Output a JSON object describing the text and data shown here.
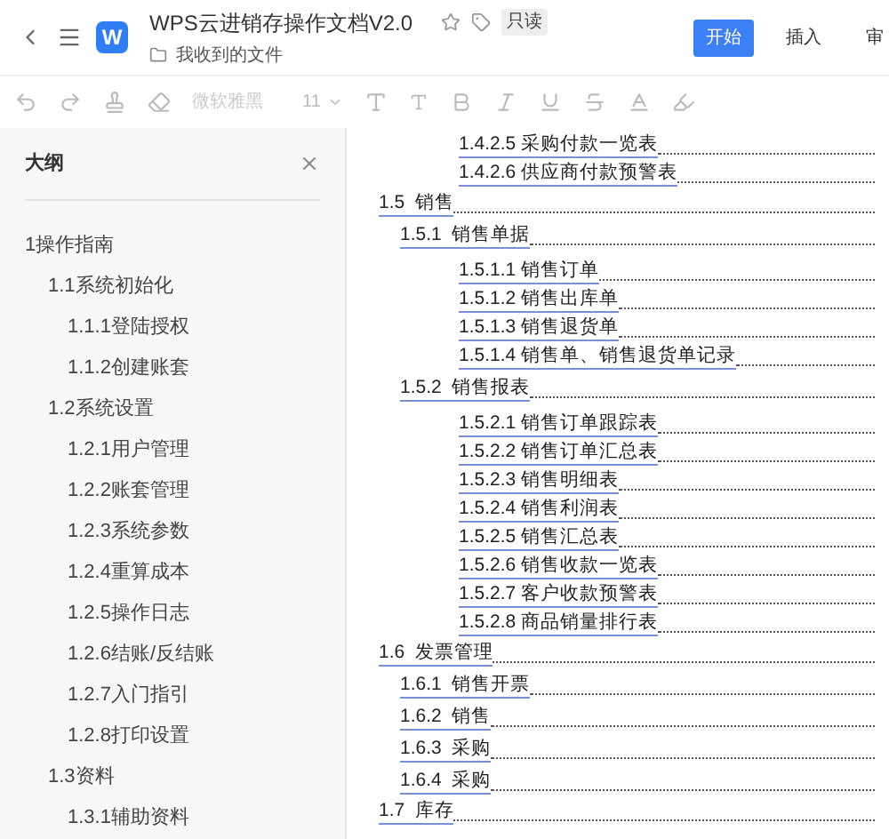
{
  "header": {
    "logo": "W",
    "title": "WPS云进销存操作文档V2.0",
    "badge": "只读",
    "folder": "我收到的文件",
    "tabs": [
      {
        "label": "开始",
        "selected": true
      },
      {
        "label": "插入",
        "selected": false
      },
      {
        "label": "审",
        "selected": false
      }
    ]
  },
  "toolbar": {
    "font": "微软雅黑",
    "size": "11"
  },
  "outline": {
    "title": "大纲",
    "items": [
      {
        "text": "1操作指南",
        "children": [
          {
            "text": "1.1系统初始化",
            "children": [
              {
                "text": "1.1.1登陆授权"
              },
              {
                "text": "1.1.2创建账套"
              }
            ]
          },
          {
            "text": "1.2系统设置",
            "children": [
              {
                "text": "1.2.1用户管理"
              },
              {
                "text": "1.2.2账套管理"
              },
              {
                "text": "1.2.3系统参数"
              },
              {
                "text": "1.2.4重算成本"
              },
              {
                "text": "1.2.5操作日志"
              },
              {
                "text": "1.2.6结账/反结账"
              },
              {
                "text": "1.2.7入门指引"
              },
              {
                "text": "1.2.8打印设置"
              }
            ]
          },
          {
            "text": "1.3资料",
            "children": [
              {
                "text": "1.3.1辅助资料"
              }
            ]
          }
        ]
      }
    ]
  },
  "toc_continued": [
    {
      "text": "1.4.2.5 采购付款一览表"
    },
    {
      "text": "1.4.2.6 供应商付款预警表"
    }
  ],
  "toc": [
    {
      "text": "1.5  销售",
      "children": [
        {
          "text": "1.5.1  销售单据",
          "children": [
            {
              "text": "1.5.1.1 销售订单"
            },
            {
              "text": "1.5.1.2 销售出库单"
            },
            {
              "text": "1.5.1.3 销售退货单"
            },
            {
              "text": "1.5.1.4 销售单、销售退货单记录"
            }
          ]
        },
        {
          "text": "1.5.2  销售报表",
          "children": [
            {
              "text": "1.5.2.1 销售订单跟踪表"
            },
            {
              "text": "1.5.2.2 销售订单汇总表"
            },
            {
              "text": "1.5.2.3 销售明细表"
            },
            {
              "text": "1.5.2.4 销售利润表"
            },
            {
              "text": "1.5.2.5 销售汇总表"
            },
            {
              "text": "1.5.2.6 销售收款一览表"
            },
            {
              "text": "1.5.2.7 客户收款预警表"
            },
            {
              "text": "1.5.2.8 商品销量排行表"
            }
          ]
        }
      ]
    },
    {
      "text": "1.6  发票管理",
      "children": [
        {
          "text": "1.6.1  销售开票"
        },
        {
          "text": "1.6.2  销售"
        },
        {
          "text": "1.6.3  采购"
        },
        {
          "text": "1.6.4  采购"
        }
      ]
    },
    {
      "text": "1.7  库存"
    }
  ]
}
